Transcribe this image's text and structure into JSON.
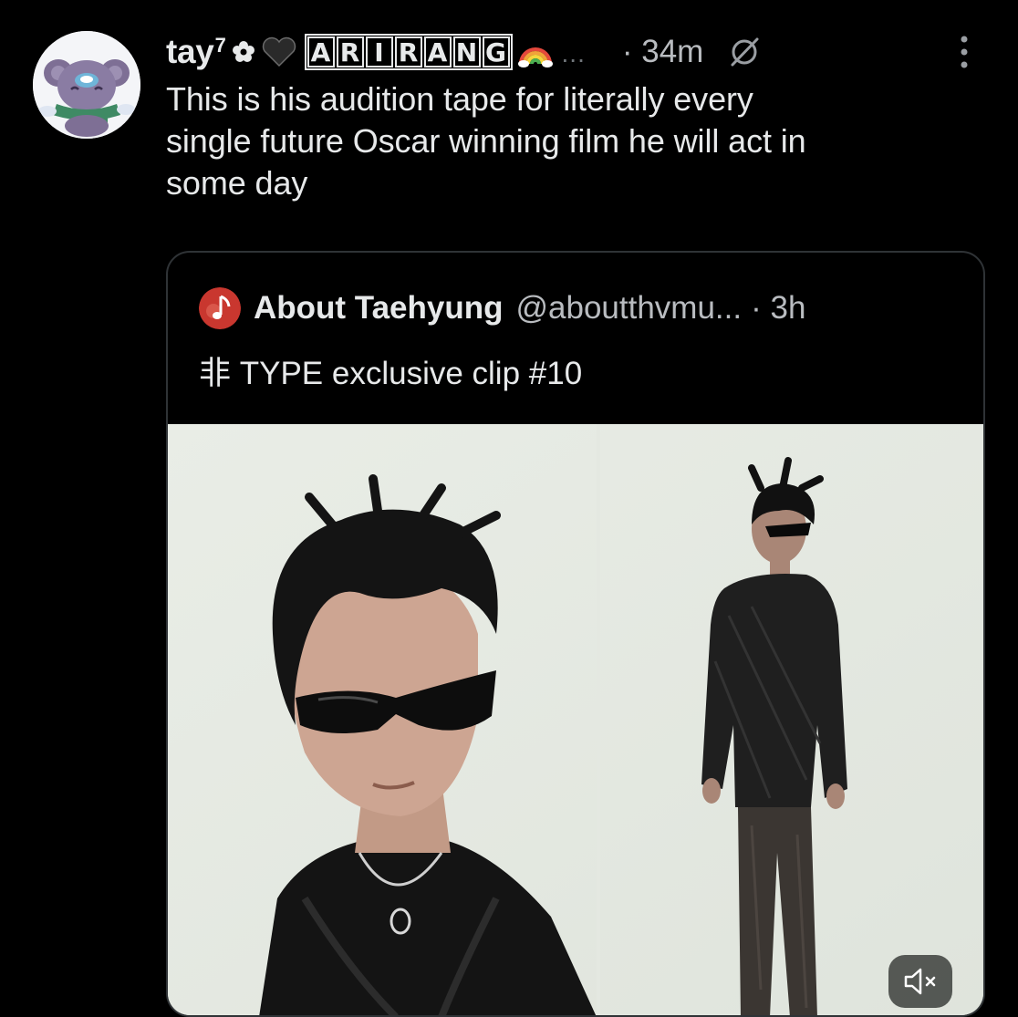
{
  "post": {
    "display_name": "tay",
    "name_superscript": "7",
    "name_letters": [
      "A",
      "R",
      "I",
      "R",
      "A",
      "N",
      "G"
    ],
    "name_ellipsis": "...",
    "timestamp": "· 34m",
    "text": "This is his audition tape for literally every\nsingle future Oscar winning film he will act in\nsome day"
  },
  "quote": {
    "display_name": "About Taehyung",
    "handle": "@aboutthvmu...",
    "timestamp": "· 3h",
    "text": "非 TYPE exclusive clip #10"
  },
  "icons": {
    "avatar": "koya-bear-avatar",
    "flower": "flower-icon",
    "heart": "black-heart-icon",
    "rainbow": "rainbow-icon",
    "grok": "grok-icon",
    "menu": "more-vertical-icon",
    "quote_avatar": "music-note-avatar",
    "mute": "speaker-muted-icon"
  },
  "colors": {
    "background": "#000000",
    "text_primary": "#e7e9ea",
    "text_secondary": "#b9bcc0",
    "card_border": "#2f3336",
    "media_background": "#e8ece6"
  }
}
